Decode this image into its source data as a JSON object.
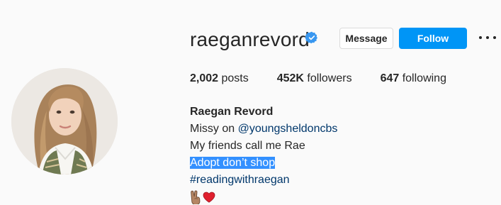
{
  "profile": {
    "username": "raegan­revord",
    "verified": true,
    "buttons": {
      "message_label": "Message",
      "follow_label": "Follow"
    },
    "stats": {
      "posts_count": "2,002",
      "posts_label": " posts",
      "followers_count": "452K",
      "followers_label": " followers",
      "following_count": "647",
      "following_label": " following"
    },
    "bio": {
      "full_name": "Raegan Revord",
      "line1_prefix": "Missy on ",
      "line1_mention": "@youngsheldoncbs",
      "line2": "My friends call me Rae",
      "line3": "Adopt don’t shop",
      "line4_hashtag": "#readingwithraegan",
      "emojis": [
        "victory-hand-icon",
        "red-heart-icon"
      ]
    }
  },
  "colors": {
    "follow_button": "#0095f6",
    "verified_badge": "#3897f0",
    "link": "#00376b",
    "selection_highlight": "#3390ff"
  },
  "icons": [
    "verified-badge-icon",
    "more-options-icon",
    "victory-hand-icon",
    "red-heart-icon"
  ]
}
